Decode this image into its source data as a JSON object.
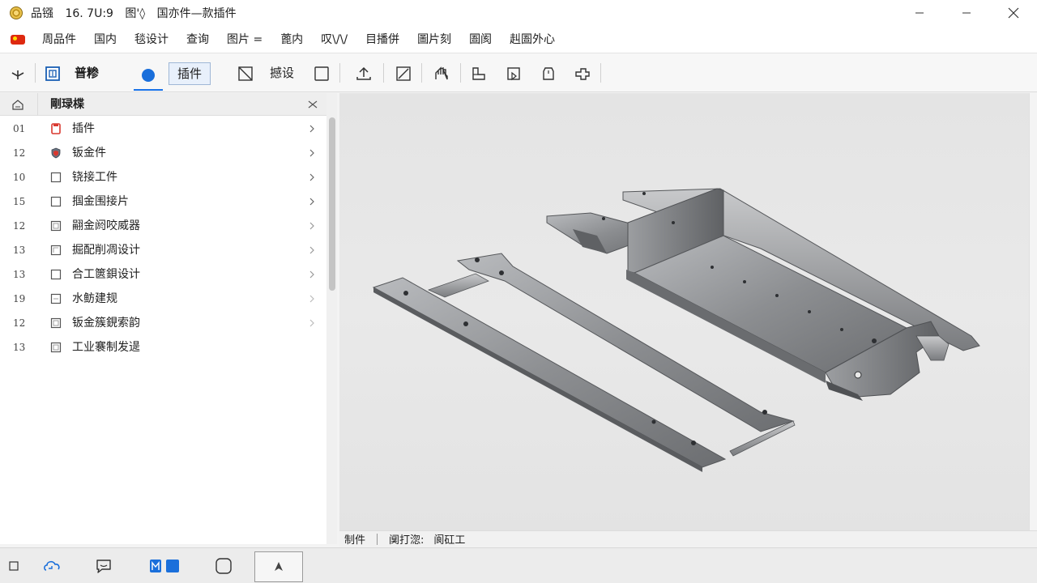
{
  "window": {
    "title_parts": [
      "品镪",
      "16. 7U:9",
      "图'◊",
      "国亦件—款插件"
    ]
  },
  "menu": {
    "items": [
      "周品件",
      "国内",
      "毯设计",
      "查询",
      "图片 =",
      "蓖内",
      "叹\\/\\/",
      "目播併",
      "圖片刻",
      "圄阂",
      "赳圄外心"
    ]
  },
  "toolbar": {
    "label_common": "普糁",
    "tab_plugin": "插件",
    "label_settings": "撼设"
  },
  "panel": {
    "title": "剛琭楪",
    "items": [
      {
        "num": "01",
        "label": "插件",
        "icon": "red-doc-icon",
        "chevron": true
      },
      {
        "num": "12",
        "label": "钣金件",
        "icon": "shield-icon",
        "chevron": true
      },
      {
        "num": "10",
        "label": "铙接工件",
        "icon": "box-icon",
        "chevron": true
      },
      {
        "num": "15",
        "label": "掴金围接片",
        "icon": "box-icon",
        "chevron": true
      },
      {
        "num": "12",
        "label": "翤金阏咬威器",
        "icon": "box-icon",
        "chevron": true
      },
      {
        "num": "13",
        "label": "掘配削凋设计",
        "icon": "box-icon",
        "chevron": true
      },
      {
        "num": "13",
        "label": "合工篋鋇设计",
        "icon": "box-icon",
        "chevron": true
      },
      {
        "num": "19",
        "label": "水鲂建规",
        "icon": "box-icon",
        "chevron": true
      },
      {
        "num": "12",
        "label": "钣金簇鋧索韵",
        "icon": "box-icon",
        "chevron": true
      },
      {
        "num": "13",
        "label": "工业褰制发遈",
        "icon": "box-icon",
        "chevron": false
      }
    ]
  },
  "status": {
    "items": [
      "制件",
      "阒打淴:",
      "阆矼工"
    ]
  },
  "colors": {
    "accent": "#1a6fdb",
    "viewport_bg": "#e6e6e6",
    "metal": "#8d8f92"
  }
}
